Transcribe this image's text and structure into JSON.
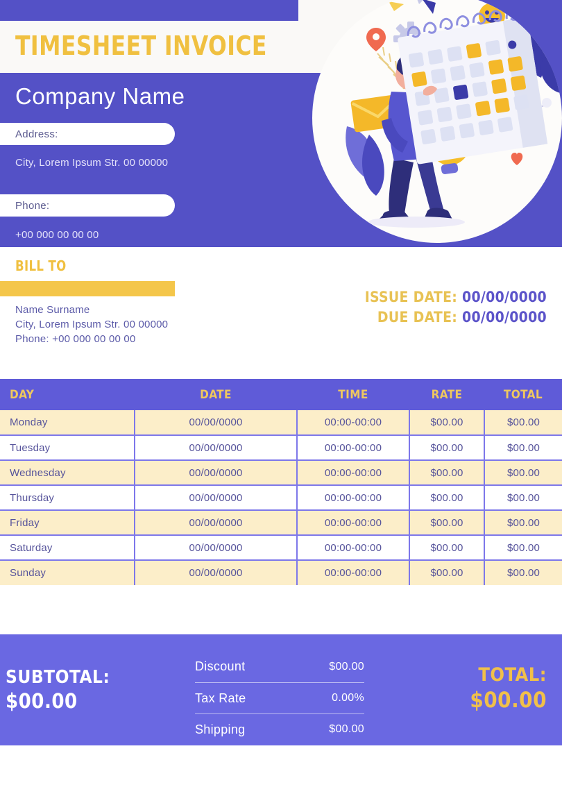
{
  "header": {
    "title": "TIMESHEET INVOICE",
    "company_name": "Company Name",
    "address_label": "Address:",
    "address_value": "City, Lorem Ipsum Str. 00 00000",
    "phone_label": "Phone:",
    "phone_value": "+00 000 00 00 00"
  },
  "bill_to": {
    "label": "BILL TO",
    "name": "Name Surname",
    "address": "City, Lorem Ipsum Str. 00 00000",
    "phone": "Phone: +00 000 00 00 00"
  },
  "dates": {
    "issue_label": "ISSUE DATE:",
    "issue_value": "00/00/0000",
    "due_label": "DUE DATE:",
    "due_value": "00/00/0000"
  },
  "table": {
    "columns": [
      "DAY",
      "DATE",
      "TIME",
      "RATE",
      "TOTAL"
    ],
    "rows": [
      {
        "day": "Monday",
        "date": "00/00/0000",
        "time": "00:00-00:00",
        "rate": "$00.00",
        "total": "$00.00"
      },
      {
        "day": "Tuesday",
        "date": "00/00/0000",
        "time": "00:00-00:00",
        "rate": "$00.00",
        "total": "$00.00"
      },
      {
        "day": "Wednesday",
        "date": "00/00/0000",
        "time": "00:00-00:00",
        "rate": "$00.00",
        "total": "$00.00"
      },
      {
        "day": "Thursday",
        "date": "00/00/0000",
        "time": "00:00-00:00",
        "rate": "$00.00",
        "total": "$00.00"
      },
      {
        "day": "Friday",
        "date": "00/00/0000",
        "time": "00:00-00:00",
        "rate": "$00.00",
        "total": "$00.00"
      },
      {
        "day": "Saturday",
        "date": "00/00/0000",
        "time": "00:00-00:00",
        "rate": "$00.00",
        "total": "$00.00"
      },
      {
        "day": "Sunday",
        "date": "00/00/0000",
        "time": "00:00-00:00",
        "rate": "$00.00",
        "total": "$00.00"
      }
    ]
  },
  "footer": {
    "subtotal_label": "SUBTOTAL:",
    "subtotal_value": "$00.00",
    "discount_label": "Discount",
    "discount_value": "$00.00",
    "tax_label": "Tax Rate",
    "tax_value": "0.00%",
    "shipping_label": "Shipping",
    "shipping_value": "$00.00",
    "total_label": "TOTAL:",
    "total_value": "$00.00"
  },
  "illustration": {
    "name": "person-marking-calendar-illustration",
    "elements": [
      "calendar-icon",
      "lightbulb-icon",
      "envelope-icon",
      "gear-icon",
      "smiley-icon",
      "heart-icon",
      "location-pin-icon",
      "leaf-icon",
      "person-figure"
    ]
  },
  "colors": {
    "purple": "#5451C6",
    "purple_light": "#6A68E2",
    "yellow": "#F0C040",
    "cream": "#FCEEC9",
    "border": "#7D77EA",
    "text_purple": "#56539B"
  }
}
